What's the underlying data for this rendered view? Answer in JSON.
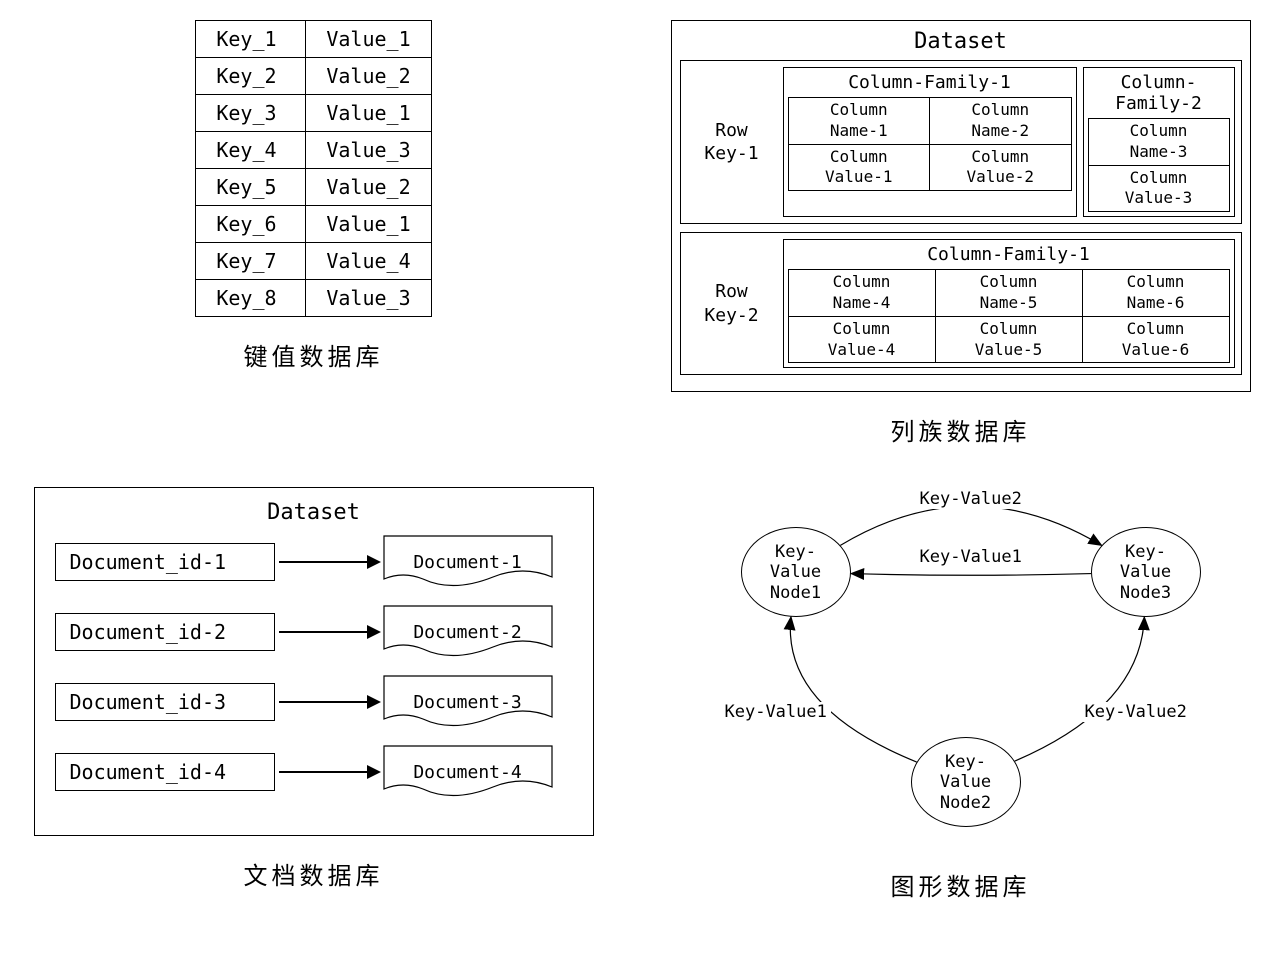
{
  "keyValue": {
    "caption": "键值数据库",
    "rows": [
      {
        "k": "Key_1",
        "v": "Value_1"
      },
      {
        "k": "Key_2",
        "v": "Value_2"
      },
      {
        "k": "Key_3",
        "v": "Value_1"
      },
      {
        "k": "Key_4",
        "v": "Value_3"
      },
      {
        "k": "Key_5",
        "v": "Value_2"
      },
      {
        "k": "Key_6",
        "v": "Value_1"
      },
      {
        "k": "Key_7",
        "v": "Value_4"
      },
      {
        "k": "Key_8",
        "v": "Value_3"
      }
    ]
  },
  "columnFamily": {
    "caption": "列族数据库",
    "title": "Dataset",
    "rows": [
      {
        "rowKey": "Row\nKey-1",
        "families": [
          {
            "name": "Column-Family-1",
            "cols": [
              {
                "name": "Column\nName-1",
                "value": "Column\nValue-1"
              },
              {
                "name": "Column\nName-2",
                "value": "Column\nValue-2"
              }
            ]
          },
          {
            "name": "Column-Family-2",
            "cols": [
              {
                "name": "Column\nName-3",
                "value": "Column\nValue-3"
              }
            ]
          }
        ]
      },
      {
        "rowKey": "Row\nKey-2",
        "families": [
          {
            "name": "Column-Family-1",
            "cols": [
              {
                "name": "Column\nName-4",
                "value": "Column\nValue-4"
              },
              {
                "name": "Column\nName-5",
                "value": "Column\nValue-5"
              },
              {
                "name": "Column\nName-6",
                "value": "Column\nValue-6"
              }
            ]
          }
        ]
      }
    ]
  },
  "documentDb": {
    "caption": "文档数据库",
    "title": "Dataset",
    "items": [
      {
        "id": "Document_id-1",
        "doc": "Document-1"
      },
      {
        "id": "Document_id-2",
        "doc": "Document-2"
      },
      {
        "id": "Document_id-3",
        "doc": "Document-3"
      },
      {
        "id": "Document_id-4",
        "doc": "Document-4"
      }
    ]
  },
  "graphDb": {
    "caption": "图形数据库",
    "nodes": [
      {
        "id": "n1",
        "label": "Key-\nValue\nNode1"
      },
      {
        "id": "n2",
        "label": "Key-\nValue\nNode2"
      },
      {
        "id": "n3",
        "label": "Key-\nValue\nNode3"
      }
    ],
    "edges": [
      {
        "from": "n1",
        "to": "n3",
        "label": "Key-Value2"
      },
      {
        "from": "n3",
        "to": "n1",
        "label": "Key-Value1"
      },
      {
        "from": "n2",
        "to": "n1",
        "label": "Key-Value1"
      },
      {
        "from": "n2",
        "to": "n3",
        "label": "Key-Value2"
      }
    ]
  }
}
